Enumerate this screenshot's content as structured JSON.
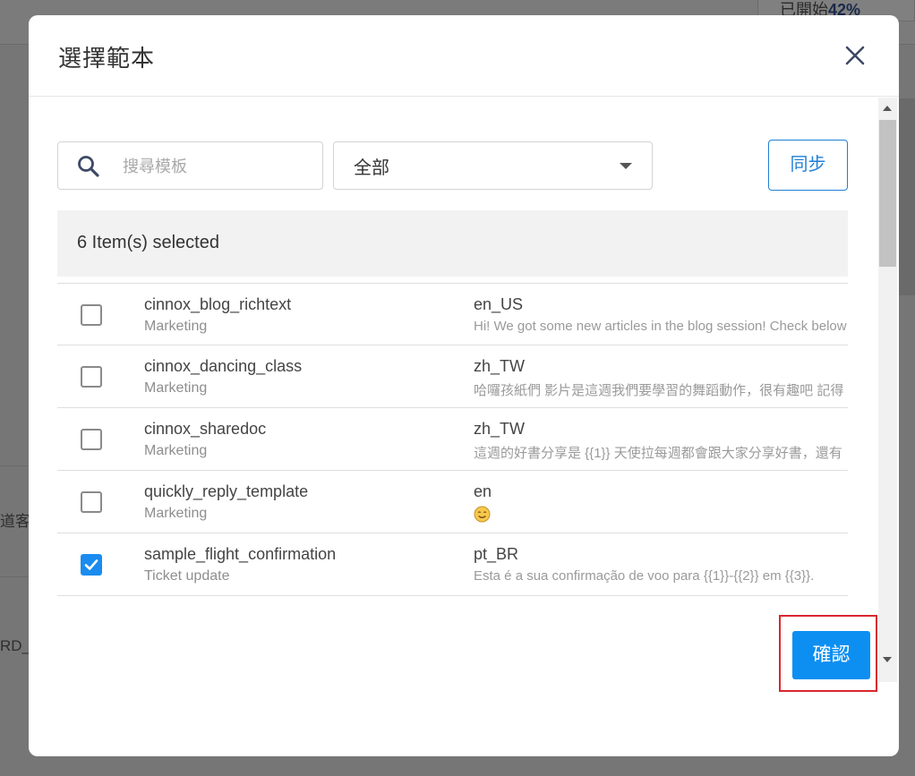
{
  "background": {
    "progress_label": "已開始",
    "progress_value": "42%",
    "side_text_1": "道客",
    "side_text_2": "RD_"
  },
  "modal": {
    "title": "選擇範本",
    "close_icon": "close-icon"
  },
  "search": {
    "placeholder": "搜尋模板",
    "value": "",
    "icon": "search-icon"
  },
  "filter": {
    "selected": "全部",
    "icon": "chevron-down-icon"
  },
  "sync_button": "同步",
  "selection_summary": "6 Item(s) selected",
  "templates": [
    {
      "name": "cinnox_blog_richtext",
      "category": "Marketing",
      "language": "en_US",
      "preview": "Hi! We got some new articles in the blog session! Check below",
      "checked": false
    },
    {
      "name": "cinnox_dancing_class",
      "category": "Marketing",
      "language": "zh_TW",
      "preview": "哈囉孩紙們 影片是這週我們要學習的舞蹈動作，很有趣吧 記得",
      "checked": false
    },
    {
      "name": "cinnox_sharedoc",
      "category": "Marketing",
      "language": "zh_TW",
      "preview": "這週的好書分享是 {{1}} 天使拉每週都會跟大家分享好書，還有",
      "checked": false
    },
    {
      "name": "quickly_reply_template",
      "category": "Marketing",
      "language": "en",
      "preview": "",
      "preview_icon": "smiling-face-emoji-icon",
      "checked": false
    },
    {
      "name": "sample_flight_confirmation",
      "category": "Ticket update",
      "language": "pt_BR",
      "preview": "Esta é a sua confirmação de voo para {{1}}-{{2}} em {{3}}.",
      "checked": true
    }
  ],
  "confirm_button": "確認",
  "colors": {
    "primary": "#0d8ff2",
    "outline": "#1e7fd6",
    "highlight": "#d8272e"
  }
}
